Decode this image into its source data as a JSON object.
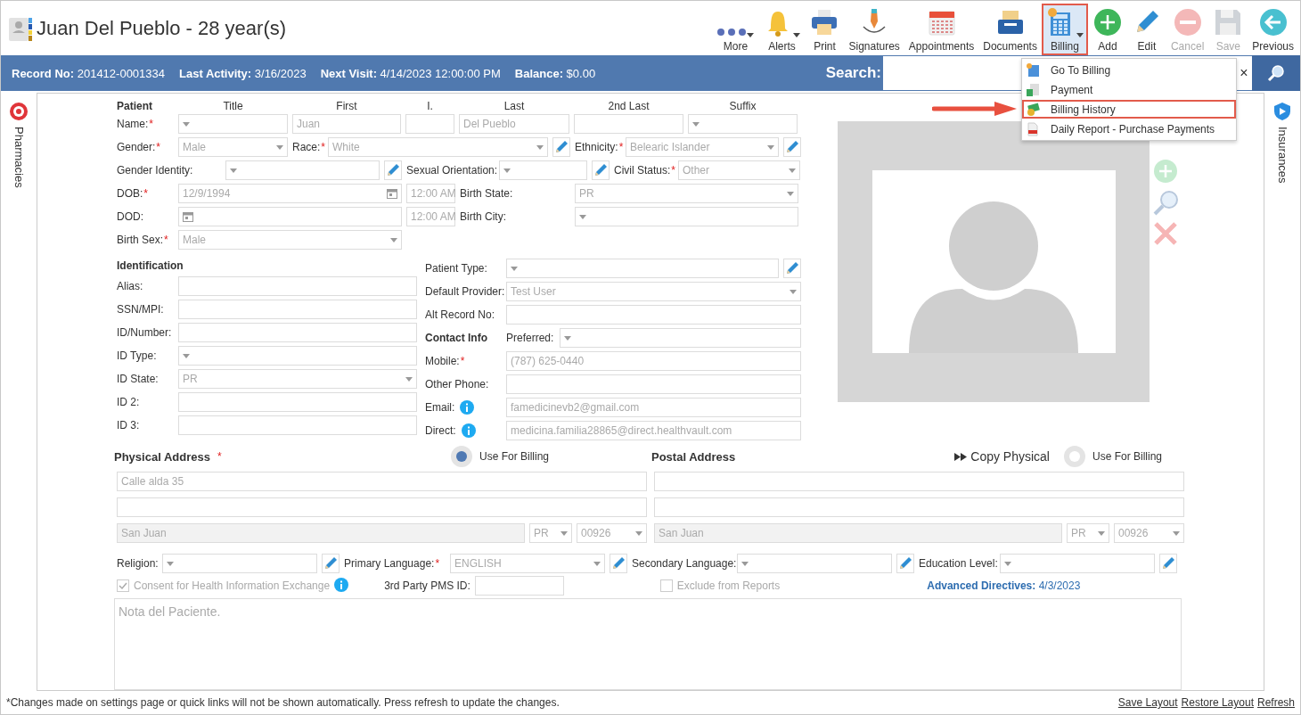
{
  "header": {
    "title": "Juan Del Pueblo - 28 year(s)"
  },
  "toolbar": [
    {
      "label": "More",
      "caret": true,
      "disabled": false,
      "selected": false
    },
    {
      "label": "Alerts",
      "caret": true,
      "disabled": false,
      "selected": false
    },
    {
      "label": "Print",
      "caret": false,
      "disabled": false,
      "selected": false
    },
    {
      "label": "Signatures",
      "caret": false,
      "disabled": false,
      "selected": false
    },
    {
      "label": "Appointments",
      "caret": false,
      "disabled": false,
      "selected": false
    },
    {
      "label": "Documents",
      "caret": false,
      "disabled": false,
      "selected": false
    },
    {
      "label": "Billing",
      "caret": true,
      "disabled": false,
      "selected": true
    },
    {
      "label": "Add",
      "caret": false,
      "disabled": false,
      "selected": false
    },
    {
      "label": "Edit",
      "caret": false,
      "disabled": false,
      "selected": false
    },
    {
      "label": "Cancel",
      "caret": false,
      "disabled": true,
      "selected": false
    },
    {
      "label": "Save",
      "caret": false,
      "disabled": true,
      "selected": false
    },
    {
      "label": "Previous",
      "caret": false,
      "disabled": false,
      "selected": false
    }
  ],
  "info_bar": {
    "items": [
      {
        "label": "Record No:",
        "value": "201412-0001334"
      },
      {
        "label": "Last Activity:",
        "value": "3/16/2023"
      },
      {
        "label": "Next Visit:",
        "value": "4/14/2023 12:00:00 PM"
      },
      {
        "label": "Balance:",
        "value": "$0.00"
      }
    ],
    "search": {
      "label": "Search:",
      "clear": "×"
    }
  },
  "billing_menu": [
    {
      "label": "Go To Billing",
      "selected": false
    },
    {
      "label": "Payment",
      "selected": false
    },
    {
      "label": "Billing History",
      "selected": true
    },
    {
      "label": "Daily Report - Purchase Payments",
      "selected": false
    }
  ],
  "side_tabs": {
    "left": "Pharmacies",
    "right": "Insurances"
  },
  "patient": {
    "heading": "Patient",
    "name_columns": [
      "Title",
      "First",
      "I.",
      "Last",
      "2nd Last",
      "Suffix"
    ],
    "lines": [
      {
        "fields": [
          {
            "kind": "label",
            "text": "Name:",
            "mark": "*"
          },
          {
            "kind": "select"
          },
          {
            "kind": "text",
            "value": "Juan"
          },
          {
            "kind": "text"
          },
          {
            "kind": "text",
            "value": "Del Pueblo"
          },
          {
            "kind": "text"
          },
          {
            "kind": "select"
          }
        ]
      },
      {
        "fields": [
          {
            "kind": "label",
            "text": "Gender:",
            "mark": "*"
          },
          {
            "kind": "select",
            "value": "Male"
          },
          {
            "kind": "label",
            "text": "Race:",
            "mark": "*"
          },
          {
            "kind": "select",
            "value": "White"
          },
          {
            "kind": "edit"
          },
          {
            "kind": "label",
            "text": "Ethnicity:",
            "mark": "*"
          },
          {
            "kind": "select",
            "value": "Belearic Islander"
          },
          {
            "kind": "edit"
          }
        ]
      },
      {
        "fields": [
          {
            "kind": "label",
            "text": "Gender Identity:"
          },
          {
            "kind": "select"
          },
          {
            "kind": "edit"
          },
          {
            "kind": "label",
            "text": "Sexual Orientation:"
          },
          {
            "kind": "select"
          },
          {
            "kind": "edit"
          },
          {
            "kind": "label",
            "text": "Civil Status:",
            "mark": "*"
          },
          {
            "kind": "select",
            "value": "Other"
          }
        ]
      },
      {
        "fields": [
          {
            "kind": "label",
            "text": "DOB:",
            "mark": "*"
          },
          {
            "kind": "date",
            "value": "12/9/1994"
          },
          {
            "kind": "time",
            "value": "12:00 AM"
          },
          {
            "kind": "label",
            "text": "Birth State:"
          },
          {
            "kind": "select",
            "value": "PR"
          }
        ]
      },
      {
        "fields": [
          {
            "kind": "label",
            "text": "DOD:"
          },
          {
            "kind": "date"
          },
          {
            "kind": "time",
            "value": "12:00 AM"
          },
          {
            "kind": "label",
            "text": "Birth City:"
          },
          {
            "kind": "select"
          }
        ]
      },
      {
        "fields": [
          {
            "kind": "label",
            "text": "Birth Sex:",
            "mark": "*"
          },
          {
            "kind": "select",
            "value": "Male"
          }
        ]
      }
    ]
  },
  "identification": {
    "heading": "Identification",
    "lines": [
      {
        "fields": [
          {
            "kind": "label",
            "text": "Alias:"
          },
          {
            "kind": "text"
          }
        ]
      },
      {
        "fields": [
          {
            "kind": "label",
            "text": "SSN/MPI:"
          },
          {
            "kind": "text"
          }
        ]
      },
      {
        "fields": [
          {
            "kind": "label",
            "text": "ID/Number:"
          },
          {
            "kind": "text"
          }
        ]
      },
      {
        "fields": [
          {
            "kind": "label",
            "text": "ID Type:"
          },
          {
            "kind": "select"
          }
        ]
      },
      {
        "fields": [
          {
            "kind": "label",
            "text": "ID State:"
          },
          {
            "kind": "select",
            "value": "PR"
          }
        ]
      },
      {
        "fields": [
          {
            "kind": "label",
            "text": "ID 2:"
          },
          {
            "kind": "text"
          }
        ]
      },
      {
        "fields": [
          {
            "kind": "label",
            "text": "ID 3:"
          },
          {
            "kind": "text"
          }
        ]
      }
    ]
  },
  "contact": {
    "lines": [
      {
        "fields": [
          {
            "kind": "label",
            "text": "Patient Type:"
          },
          {
            "kind": "select"
          },
          {
            "kind": "edit"
          }
        ]
      },
      {
        "fields": [
          {
            "kind": "label",
            "text": "Default Provider:"
          },
          {
            "kind": "select",
            "value": "Test User"
          }
        ]
      },
      {
        "fields": [
          {
            "kind": "label",
            "text": "Alt Record No:"
          },
          {
            "kind": "text"
          }
        ]
      },
      {
        "fields": [
          {
            "kind": "heading",
            "text": "Contact Info"
          },
          {
            "kind": "label",
            "text": "Preferred:"
          },
          {
            "kind": "select"
          }
        ]
      },
      {
        "fields": [
          {
            "kind": "label",
            "text": "Mobile:",
            "mark": "*"
          },
          {
            "kind": "text",
            "value": "(787) 625-0440"
          }
        ]
      },
      {
        "fields": [
          {
            "kind": "label",
            "text": "Other Phone:"
          },
          {
            "kind": "text"
          }
        ]
      },
      {
        "fields": [
          {
            "kind": "label",
            "text": "Email:",
            "info": true
          },
          {
            "kind": "text",
            "value": "famedicinevb2@gmail.com"
          }
        ]
      },
      {
        "fields": [
          {
            "kind": "label",
            "text": "Direct:",
            "info": true
          },
          {
            "kind": "text",
            "value": "medicina.familia28865@direct.healthvault.com"
          }
        ]
      }
    ]
  },
  "addresses": [
    {
      "heading": "Physical Address",
      "mark": "*",
      "use_for_billing": {
        "label": "Use For Billing",
        "selected": true
      },
      "lines": [
        {
          "kind": "text",
          "value": "Calle alda 35"
        },
        {
          "kind": "text"
        },
        {
          "kind": "city",
          "value": "San Juan"
        },
        {
          "kind": "select",
          "value": "PR"
        },
        {
          "kind": "select",
          "value": "00926"
        }
      ]
    },
    {
      "heading": "Postal Address",
      "copy": "Copy Physical",
      "use_for_billing": {
        "label": "Use For Billing",
        "selected": false
      },
      "lines": [
        {
          "kind": "text"
        },
        {
          "kind": "text"
        },
        {
          "kind": "city",
          "value": "San Juan"
        },
        {
          "kind": "select",
          "value": "PR"
        },
        {
          "kind": "select",
          "value": "00926"
        }
      ]
    }
  ],
  "preferences": [
    {
      "kind": "label",
      "text": "Religion:"
    },
    {
      "kind": "select"
    },
    {
      "kind": "edit"
    },
    {
      "kind": "label",
      "text": "Primary Language:",
      "mark": "*"
    },
    {
      "kind": "select",
      "value": "ENGLISH"
    },
    {
      "kind": "edit"
    },
    {
      "kind": "label",
      "text": "Secondary Language:"
    },
    {
      "kind": "select"
    },
    {
      "kind": "edit"
    },
    {
      "kind": "label",
      "text": "Education Level:"
    },
    {
      "kind": "select"
    },
    {
      "kind": "edit"
    }
  ],
  "options": {
    "consent": {
      "label": "Consent for Health Information Exchange",
      "checked": true
    },
    "pms_id": {
      "label": "3rd Party PMS ID:"
    },
    "exclude": {
      "label": "Exclude from Reports",
      "checked": false
    },
    "advanced_directives": {
      "label": "Advanced Directives:",
      "value": "4/3/2023"
    }
  },
  "notes": {
    "placeholder": "Nota del Paciente."
  },
  "footer": {
    "note": "*Changes made on settings page or quick links will not be shown automatically. Press refresh to update the changes.",
    "links": [
      "Save Layout",
      "Restore Layout",
      "Refresh"
    ]
  }
}
